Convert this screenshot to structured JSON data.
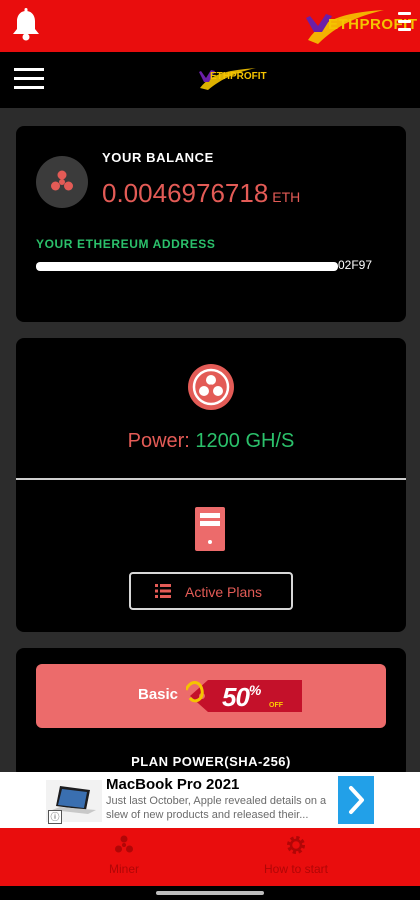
{
  "app": {
    "brand_name": "ETHPROFIT"
  },
  "balance": {
    "label": "YOUR BALANCE",
    "value": "0.0046976718",
    "unit": "ETH",
    "address_label": "YOUR ETHEREUM ADDRESS",
    "address_visible_tail": "02F97"
  },
  "power": {
    "label": "Power:",
    "value": "1200 GH/S",
    "active_plans_label": "Active Plans"
  },
  "plan": {
    "name": "Basic",
    "discount": "50",
    "discount_symbol": "%",
    "discount_suffix": "OFF",
    "power_label": "PLAN POWER(SHA-256)"
  },
  "ad": {
    "title": "MacBook Pro 2021",
    "description": "Just last October, Apple revealed details on a slew of new products and released their..."
  },
  "bottom_nav": {
    "items": [
      {
        "label": "Miner",
        "icon": "fan-icon"
      },
      {
        "label": "How to start",
        "icon": "settings-gear-icon"
      }
    ]
  },
  "colors": {
    "header_red": "#e90d0d",
    "accent_coral": "#e35b56",
    "accent_green": "#2bc16b",
    "plan_banner": "#ec6b6b",
    "ad_button_blue": "#22a0e8"
  }
}
